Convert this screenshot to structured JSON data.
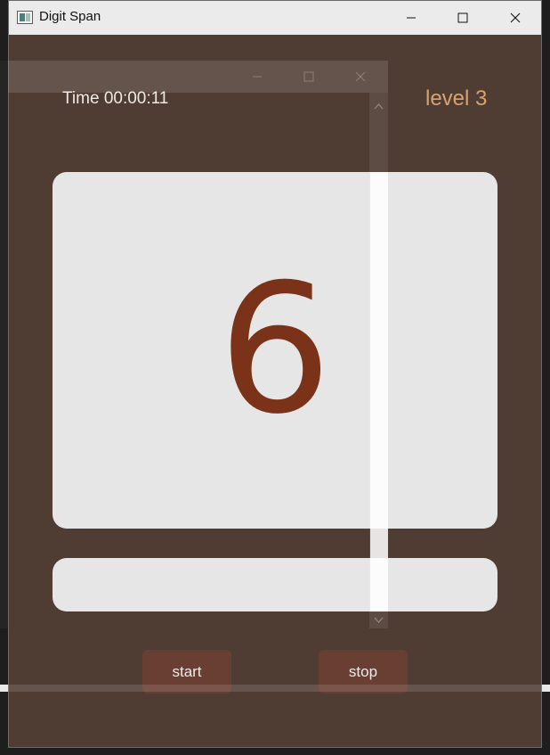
{
  "window": {
    "title": "Digit Span"
  },
  "status": {
    "time_label": "Time",
    "time_value": "00:00:11",
    "level_text": "level 3"
  },
  "display": {
    "digit": "6"
  },
  "input": {
    "value": "",
    "placeholder": ""
  },
  "controls": {
    "start_label": "start",
    "stop_label": "stop"
  },
  "colors": {
    "background": "#4f3d34",
    "card": "#e7e6e7",
    "digit": "#7a3319",
    "level": "#d9a36d",
    "button": "#693e33"
  }
}
